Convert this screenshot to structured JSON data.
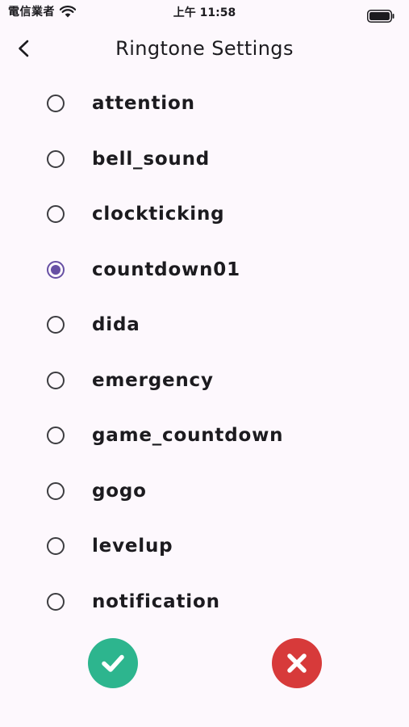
{
  "status_bar": {
    "carrier": "電信業者",
    "time": "上午 11:58"
  },
  "header": {
    "title": "Ringtone Settings"
  },
  "ringtones": [
    {
      "label": "attention",
      "selected": false
    },
    {
      "label": "bell_sound",
      "selected": false
    },
    {
      "label": "clockticking",
      "selected": false
    },
    {
      "label": "countdown01",
      "selected": true
    },
    {
      "label": "dida",
      "selected": false
    },
    {
      "label": "emergency",
      "selected": false
    },
    {
      "label": "game_countdown",
      "selected": false
    },
    {
      "label": "gogo",
      "selected": false
    },
    {
      "label": "levelup",
      "selected": false
    },
    {
      "label": "notification",
      "selected": false
    }
  ],
  "actions": {
    "confirm": {
      "icon": "check-icon",
      "color": "#2db58e"
    },
    "cancel": {
      "icon": "close-icon",
      "color": "#d73a3a"
    }
  },
  "colors": {
    "background": "#fdf8fd",
    "accent": "#6750a4",
    "radio_border": "#3d3d41"
  }
}
